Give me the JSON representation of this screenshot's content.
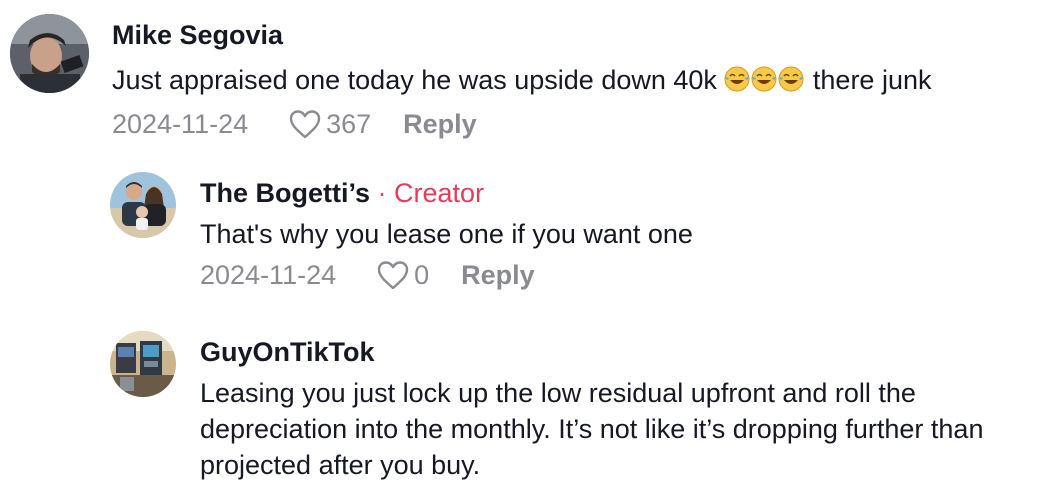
{
  "comments": [
    {
      "username": "Mike Segovia",
      "text_before": "Just appraised one today he was upside down 40k ",
      "emoji_icon": "joy-emoji",
      "emoji_count": 3,
      "text_after": " there junk",
      "date": "2024-11-24",
      "likes": "367",
      "reply_label": "Reply"
    },
    {
      "username": "The Bogetti’s",
      "creator_tag": "· Creator",
      "text": "That's why you lease one if you want one",
      "date": "2024-11-24",
      "likes": "0",
      "reply_label": "Reply"
    },
    {
      "username": "GuyOnTikTok",
      "text": "Leasing you just lock up the low residual upfront and roll the depreciation into the monthly. It’s not like it’s dropping further than projected after you buy."
    }
  ],
  "icons": {
    "like": "heart-outline-icon"
  },
  "colors": {
    "creator_accent": "#e63b5b",
    "meta_gray": "#8a8b91",
    "text": "#161823"
  }
}
